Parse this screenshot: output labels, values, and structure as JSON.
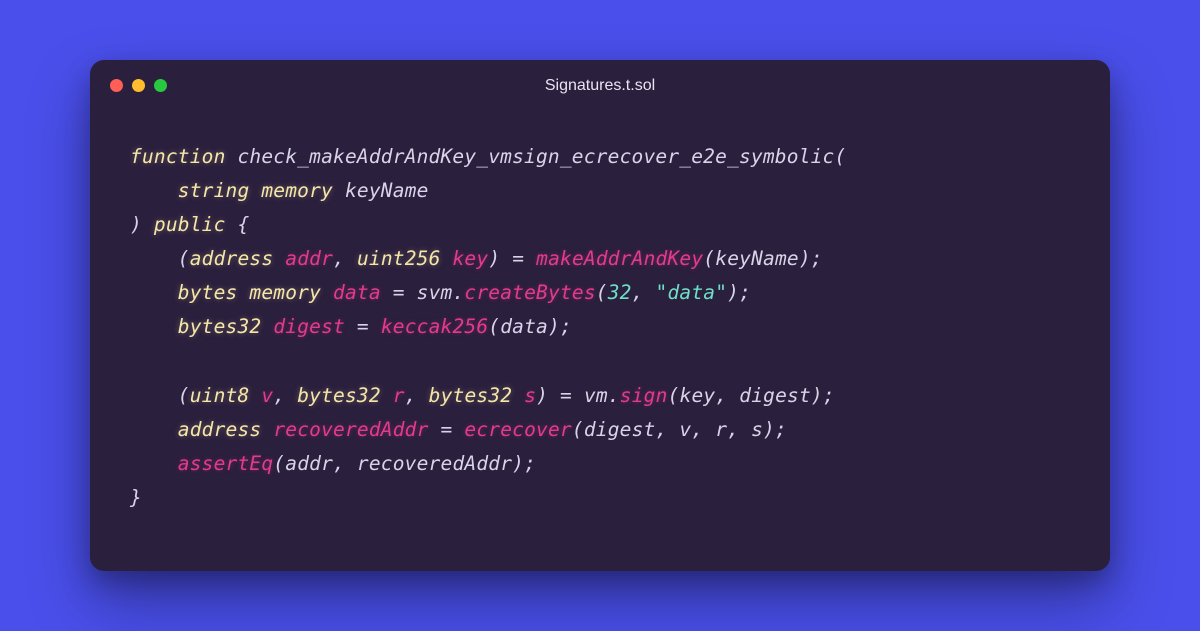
{
  "window": {
    "title": "Signatures.t.sol"
  },
  "colors": {
    "background": "#4a4feb",
    "window_bg": "#2a1f3d",
    "traffic_red": "#ff5f57",
    "traffic_yellow": "#febc2e",
    "traffic_green": "#28c840",
    "keyword": "#f5e6a8",
    "variable": "#e33a8c",
    "punct": "#d9d3e8",
    "literal": "#6fe0c8"
  },
  "code": {
    "l1": {
      "kw_function": "function",
      "fn_name": "check_makeAddrAndKey_vmsign_ecrecover_e2e_symbolic",
      "open": "("
    },
    "l2": {
      "type_string": "string",
      "kw_memory": "memory",
      "param": "keyName"
    },
    "l3": {
      "close": ")",
      "kw_public": "public",
      "brace": "{"
    },
    "l4": {
      "open": "(",
      "type_address": "address",
      "var_addr": "addr",
      "comma1": ",",
      "type_uint256": "uint256",
      "var_key": "key",
      "close": ")",
      "eq": "=",
      "fn": "makeAddrAndKey",
      "args_open": "(",
      "arg": "keyName",
      "args_close": ");"
    },
    "l5": {
      "type_bytes": "bytes",
      "kw_memory": "memory",
      "var_data": "data",
      "eq": "=",
      "obj": "svm",
      "dot": ".",
      "fn": "createBytes",
      "args_open": "(",
      "num": "32",
      "comma": ",",
      "str": "\"data\"",
      "args_close": ");"
    },
    "l6": {
      "type_bytes32": "bytes32",
      "var_digest": "digest",
      "eq": "=",
      "fn": "keccak256",
      "args_open": "(",
      "arg": "data",
      "args_close": ");"
    },
    "l8": {
      "open": "(",
      "type_uint8": "uint8",
      "var_v": "v",
      "c1": ",",
      "type_bytes32_1": "bytes32",
      "var_r": "r",
      "c2": ",",
      "type_bytes32_2": "bytes32",
      "var_s": "s",
      "close": ")",
      "eq": "=",
      "obj": "vm",
      "dot": ".",
      "fn": "sign",
      "args_open": "(",
      "a1": "key",
      "ac1": ",",
      "a2": "digest",
      "args_close": ");"
    },
    "l9": {
      "type_address": "address",
      "var": "recoveredAddr",
      "eq": "=",
      "fn": "ecrecover",
      "args_open": "(",
      "a1": "digest",
      "c1": ",",
      "a2": "v",
      "c2": ",",
      "a3": "r",
      "c3": ",",
      "a4": "s",
      "args_close": ");"
    },
    "l10": {
      "fn": "assertEq",
      "args_open": "(",
      "a1": "addr",
      "c1": ",",
      "a2": "recoveredAddr",
      "args_close": ");"
    },
    "l11": {
      "brace": "}"
    }
  }
}
